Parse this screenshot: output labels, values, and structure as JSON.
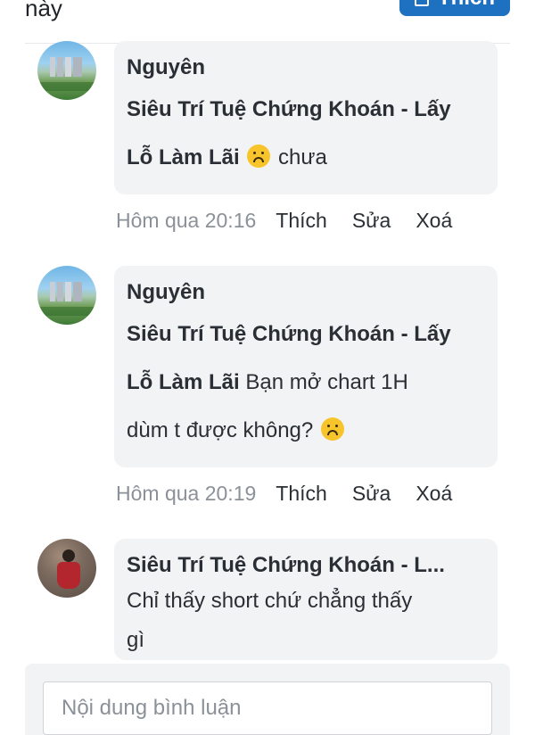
{
  "top": {
    "partial_text": "này",
    "button_label": "Thích"
  },
  "comments": [
    {
      "author": "Nguyên",
      "mention": "Siêu Trí Tuệ Chứng Khoán - Lấy Lỗ Làm Lãi",
      "mention_line1": "Siêu Trí Tuệ Chứng Khoán - Lấy",
      "mention_line2": "Lỗ Làm Lãi",
      "text": "chưa",
      "emoji": "upside-down-face",
      "time": "Hôm qua 20:16",
      "actions": [
        "Thích",
        "Sửa",
        "Xoá"
      ]
    },
    {
      "author": "Nguyên",
      "mention": "Siêu Trí Tuệ Chứng Khoán - Lấy Lỗ Làm Lãi",
      "mention_line1": "Siêu Trí Tuệ Chứng Khoán - Lấy",
      "mention_line2": "Lỗ Làm Lãi",
      "text_line1": "Bạn mở chart 1H",
      "text_line2": "dùm t được không?",
      "emoji": "upside-down-face",
      "time": "Hôm qua 20:19",
      "actions": [
        "Thích",
        "Sửa",
        "Xoá"
      ]
    },
    {
      "author": "Siêu Trí Tuệ Chứng Khoán - L...",
      "text_line1": "Chỉ thấy short chứ chẳng thấy",
      "text_line2": "gì"
    }
  ],
  "composer": {
    "placeholder": "Nội dung bình luận"
  }
}
